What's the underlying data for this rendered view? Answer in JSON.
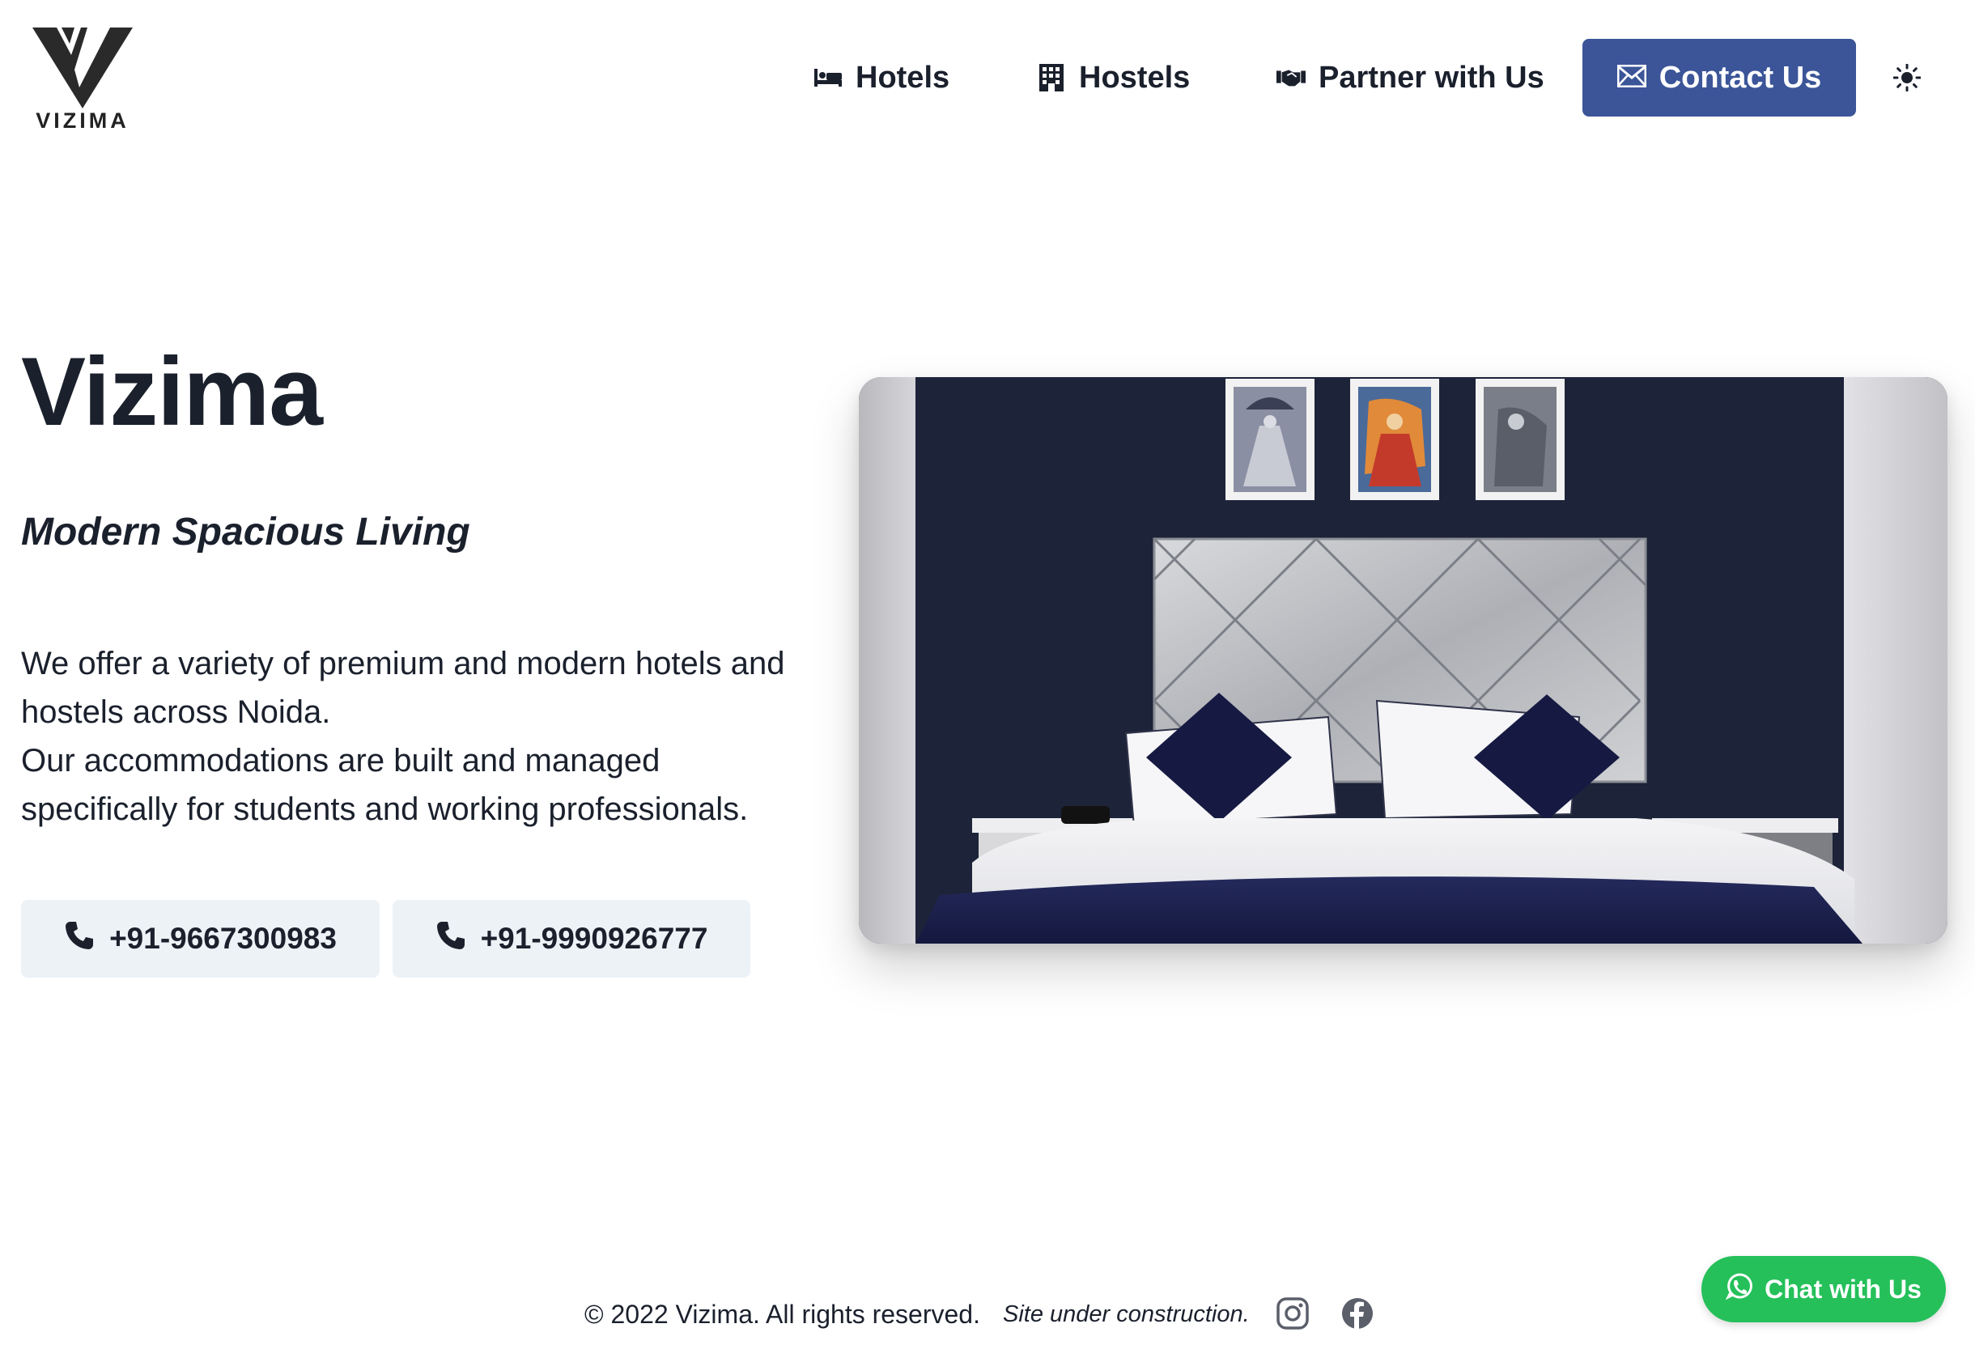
{
  "header": {
    "logo_text": "VIZIMA",
    "nav": [
      {
        "label": "Hotels",
        "icon": "bed-icon"
      },
      {
        "label": "Hostels",
        "icon": "building-icon"
      },
      {
        "label": "Partner with Us",
        "icon": "handshake-icon"
      }
    ],
    "contact": {
      "label": "Contact Us",
      "icon": "envelope-icon"
    },
    "theme_toggle_icon": "sun-icon"
  },
  "hero": {
    "title": "Vizima",
    "subtitle": "Modern Spacious Living",
    "description_line1": "We offer a variety of premium and modern hotels and hostels across Noida.",
    "description_line2": "Our accommodations are built and managed specifically for students and working professionals.",
    "phones": [
      {
        "label": "+91-9667300983",
        "icon": "phone-icon"
      },
      {
        "label": "+91-9990926777",
        "icon": "phone-icon"
      }
    ]
  },
  "footer": {
    "copyright": "© 2022 Vizima. All rights reserved.",
    "notice": "Site under construction.",
    "social": [
      "instagram-icon",
      "facebook-icon"
    ]
  },
  "chat": {
    "label": "Chat with Us",
    "icon": "whatsapp-icon"
  },
  "colors": {
    "primary": "#3b5598",
    "text": "#1a202c",
    "button_bg": "#edf2f7",
    "whatsapp": "#25c05a"
  }
}
